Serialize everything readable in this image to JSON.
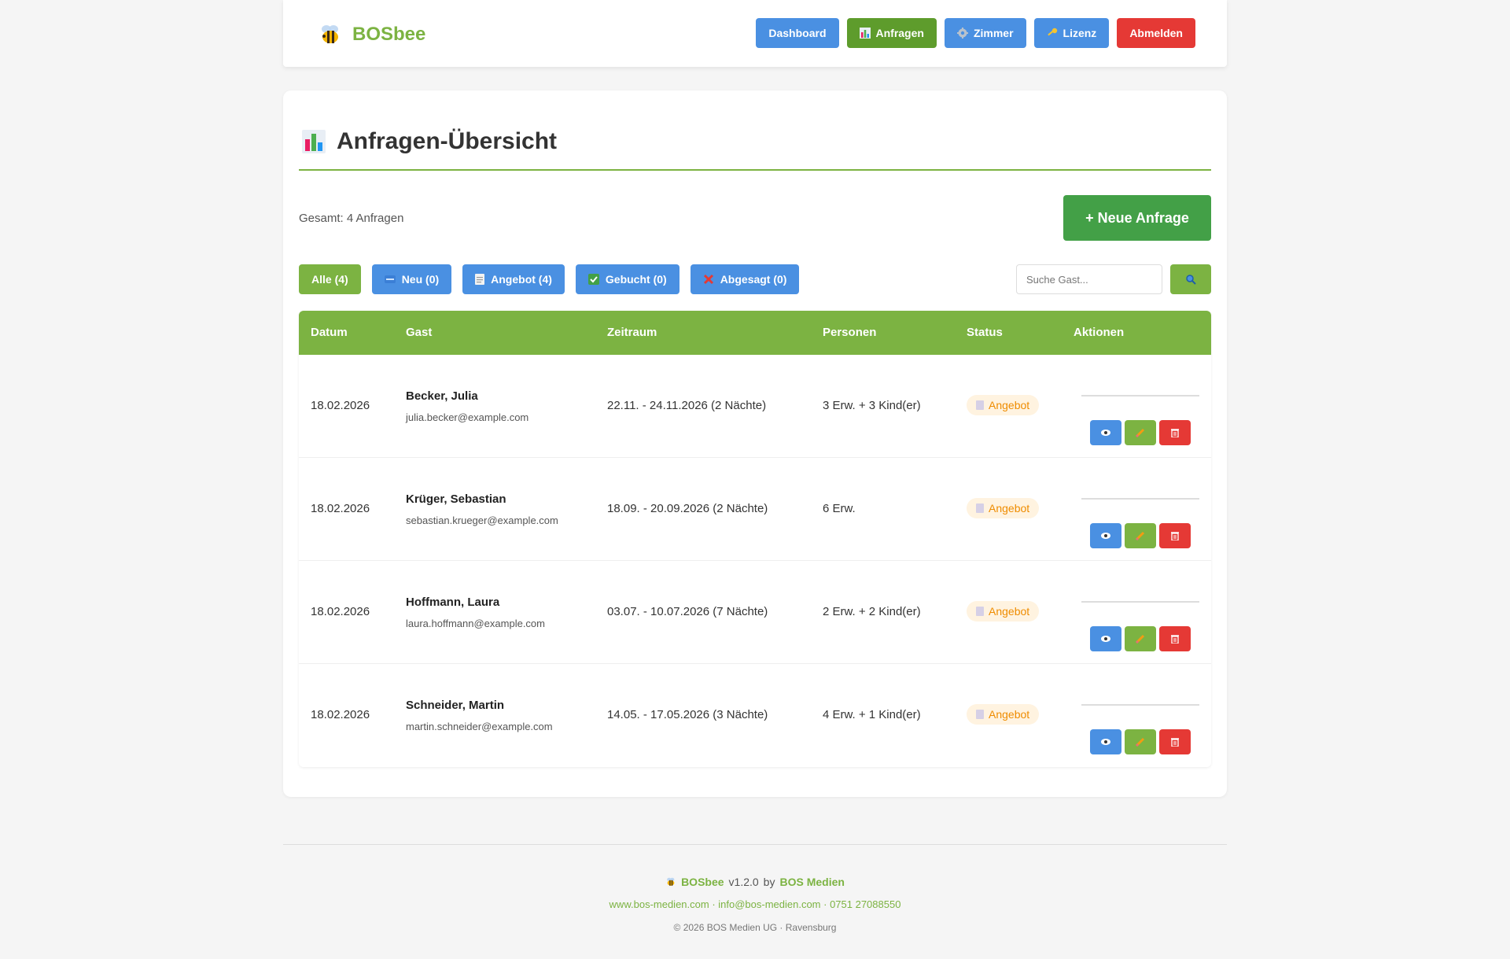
{
  "header": {
    "brand": "BOSbee",
    "nav": [
      {
        "label": "Dashboard",
        "icon": ""
      },
      {
        "label": "Anfragen",
        "icon": "bar-chart-icon"
      },
      {
        "label": "Zimmer",
        "icon": "gear-icon"
      },
      {
        "label": "Lizenz",
        "icon": "key-icon"
      },
      {
        "label": "Abmelden",
        "icon": ""
      }
    ]
  },
  "page": {
    "title": "Anfragen-Übersicht",
    "total": "Gesamt: 4 Anfragen",
    "new_button": "+ Neue Anfrage"
  },
  "filters": [
    {
      "label": "Alle (4)",
      "icon": ""
    },
    {
      "label": "Neu (0)",
      "icon": "new-icon"
    },
    {
      "label": "Angebot (4)",
      "icon": "document-icon"
    },
    {
      "label": "Gebucht (0)",
      "icon": "check-icon"
    },
    {
      "label": "Abgesagt (0)",
      "icon": "cross-icon"
    }
  ],
  "search": {
    "placeholder": "Suche Gast..."
  },
  "table": {
    "headers": [
      "Datum",
      "Gast",
      "Zeitraum",
      "Personen",
      "Status",
      "Aktionen"
    ],
    "rows": [
      {
        "date": "18.02.2026",
        "name": "Becker, Julia",
        "email": "julia.becker@example.com",
        "period": "22.11. - 24.11.2026 (2 Nächte)",
        "persons": "3 Erw. + 3 Kind(er)",
        "status": "Angebot"
      },
      {
        "date": "18.02.2026",
        "name": "Krüger, Sebastian",
        "email": "sebastian.krueger@example.com",
        "period": "18.09. - 20.09.2026 (2 Nächte)",
        "persons": "6 Erw.",
        "status": "Angebot"
      },
      {
        "date": "18.02.2026",
        "name": "Hoffmann, Laura",
        "email": "laura.hoffmann@example.com",
        "period": "03.07. - 10.07.2026 (7 Nächte)",
        "persons": "2 Erw. + 2 Kind(er)",
        "status": "Angebot"
      },
      {
        "date": "18.02.2026",
        "name": "Schneider, Martin",
        "email": "martin.schneider@example.com",
        "period": "14.05. - 17.05.2026 (3 Nächte)",
        "persons": "4 Erw. + 1 Kind(er)",
        "status": "Angebot"
      }
    ]
  },
  "footer": {
    "brand": "BOSbee",
    "version": "v1.2.0",
    "by": "by",
    "company": "BOS Medien",
    "contact": "www.bos-medien.com · info@bos-medien.com · 0751 27088550",
    "copyright": "© 2026 BOS Medien UG · Ravensburg"
  },
  "colors": {
    "brand_green": "#7cb342",
    "nav_blue": "#4a90e2",
    "logout_red": "#e53935",
    "status_orange": "#ef8c00"
  }
}
